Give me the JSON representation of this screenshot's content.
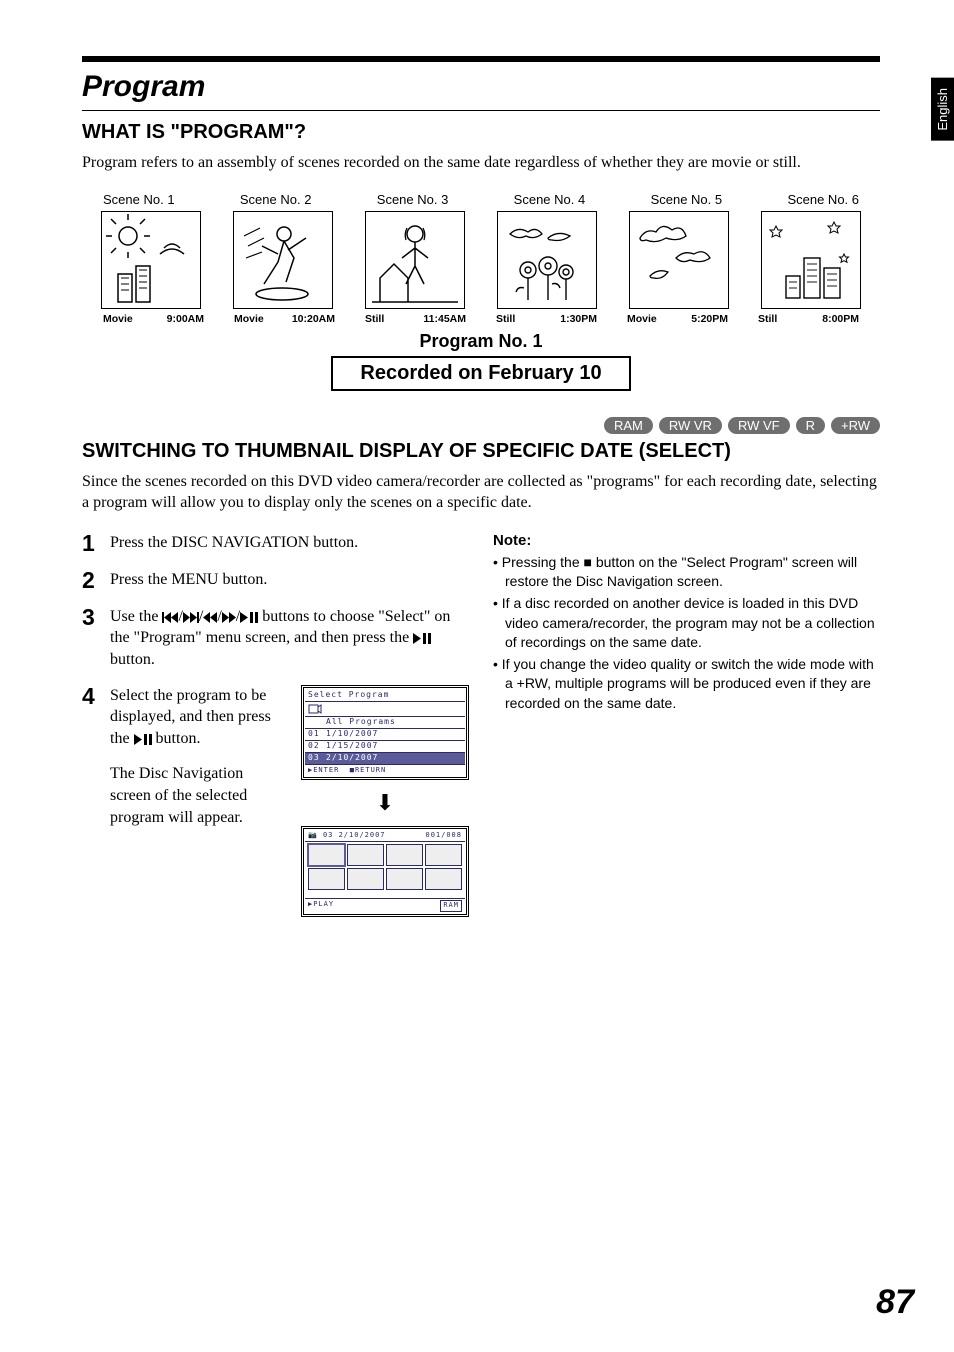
{
  "side_tab": "English",
  "title_main": "Program",
  "h2_what": "WHAT IS \"PROGRAM\"?",
  "body_what": "Program refers to an assembly of scenes recorded on the same date regardless of whether they are movie or still.",
  "scenes": [
    {
      "label": "Scene No. 1",
      "type": "Movie",
      "time": "9:00AM"
    },
    {
      "label": "Scene No. 2",
      "type": "Movie",
      "time": "10:20AM"
    },
    {
      "label": "Scene No. 3",
      "type": "Still",
      "time": "11:45AM"
    },
    {
      "label": "Scene No. 4",
      "type": "Still",
      "time": "1:30PM"
    },
    {
      "label": "Scene No. 5",
      "type": "Movie",
      "time": "5:20PM"
    },
    {
      "label": "Scene No. 6",
      "type": "Still",
      "time": "8:00PM"
    }
  ],
  "program_caption": "Program No. 1",
  "program_box": "Recorded on February 10",
  "disc_tags": [
    "RAM",
    "RW VR",
    "RW VF",
    "R",
    "+RW"
  ],
  "h2_switch": "SWITCHING TO THUMBNAIL DISPLAY OF SPECIFIC DATE (SELECT)",
  "body_switch": "Since the scenes recorded on this DVD video camera/recorder are collected as \"programs\" for each recording date, selecting a program will allow you to display only the scenes on a specific date.",
  "steps": {
    "1": "Press the DISC NAVIGATION button.",
    "2": "Press the MENU button.",
    "3_pre": "Use the ",
    "3_post": " buttons to choose \"Select\" on the \"Program\" menu screen, and then press the ",
    "3_end": " button.",
    "4_pre": "Select the program to be displayed, and then press the ",
    "4_post": " button.",
    "4_para2": "The Disc Navigation screen of the selected program will appear."
  },
  "note_head": "Note:",
  "notes": [
    "Pressing the ■ button on the \"Select Program\" screen will restore the Disc Navigation screen.",
    "If a disc recorded on another device is loaded in this DVD video camera/recorder, the program may not be a collection of recordings on the same date.",
    "If you change the video quality or switch the wide mode with a +RW, multiple programs will be produced even if they are recorded on the same date."
  ],
  "osd1": {
    "title": "Select Program",
    "rows": [
      {
        "n": "",
        "text": "All Programs"
      },
      {
        "n": "01",
        "text": " 1/10/2007"
      },
      {
        "n": "02",
        "text": " 1/15/2007"
      },
      {
        "n": "03",
        "text": " 2/10/2007",
        "sel": true
      }
    ],
    "footer_left": "ENTER",
    "footer_right": "RETURN"
  },
  "osd2": {
    "hdr_left": "03  2/10/2007",
    "hdr_right": "001/008",
    "ftr_left": "PLAY",
    "ftr_right": "RAM"
  },
  "page_number": "87"
}
